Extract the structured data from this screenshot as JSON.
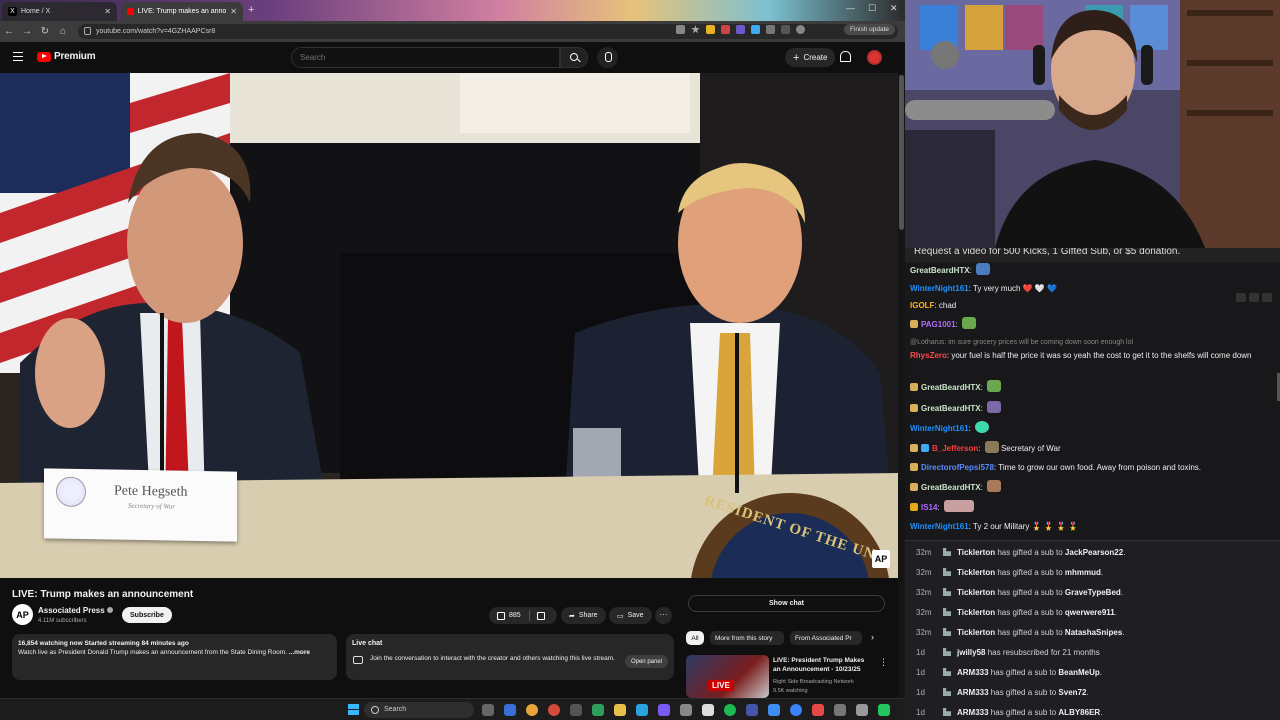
{
  "browser": {
    "tabs": [
      {
        "label": "Home / X",
        "active": false
      },
      {
        "label": "LIVE: Trump makes an anno",
        "active": true
      }
    ],
    "new_tab": "+",
    "url": "youtube.com/watch?v=4GZHAAPCsr8",
    "finish_update": "Finish update"
  },
  "yt": {
    "logo_text": "Premium",
    "search_placeholder": "Search",
    "create_label": "Create"
  },
  "video": {
    "nameplate_name": "Pete Hegseth",
    "nameplate_title": "Secretary of War",
    "seal_text": "RESIDENT OF THE UNI",
    "watermark": "AP"
  },
  "info": {
    "title": "LIVE: Trump makes an announcement",
    "channel_initials": "AP",
    "channel_name": "Associated Press",
    "subscribers": "4.11M subscribers",
    "subscribe_label": "Subscribe",
    "likes": "885",
    "share_label": "Share",
    "save_label": "Save",
    "more_label": "···",
    "stats": "16,854 watching now  Started streaming 84 minutes ago",
    "description": "Watch live as President Donald Trump makes an announcement from the State Dining Room.",
    "desc_more": "...more",
    "livechat_title": "Live chat",
    "livechat_desc": "Join the conversation to interact with the creator and others watching this live stream.",
    "open_panel": "Open panel",
    "show_chat": "Show chat"
  },
  "chips": [
    "All",
    "More from this story",
    "From Associated Pr"
  ],
  "recommendation": {
    "badge": "LIVE",
    "title": "LIVE: President Trump Makes an Announcement - 10/23/25",
    "channel": "Right Side Broadcasting Network",
    "watching": "9.5K watching"
  },
  "chat": {
    "banner": "Request a video for 500 Kicks, 1 Gifted Sub, or $5 donation.",
    "messages": [
      {
        "user": "GreatBeardHTX",
        "color": "#c9e6c9",
        "text": "",
        "emote": true
      },
      {
        "user": "WinterNight161",
        "color": "#1e90ff",
        "text": "Ty very much ❤️ 🤍 💙",
        "emote": false
      },
      {
        "user": "IGOLF",
        "color": "#ffb31a",
        "text": "chad",
        "emote": false
      },
      {
        "user": "PAG1001",
        "color": "#b16cff",
        "text": "",
        "emote": true
      },
      {
        "reply": "@Lotharus: im sure grocery prices will be coming down soon enough lol"
      },
      {
        "user": "RhysZero",
        "color": "#ff4a4a",
        "text": "your fuel is half the price it was so yeah the cost to get it to the shelfs will come down",
        "emote": false
      },
      {
        "user": "GreatBeardHTX",
        "color": "#c9e6c9",
        "text": "",
        "emote": true
      },
      {
        "user": "GreatBeardHTX",
        "color": "#c9e6c9",
        "text": "",
        "emote": true
      },
      {
        "user": "WinterNight161",
        "color": "#1e90ff",
        "text": "",
        "emote": true
      },
      {
        "user": "B_Jefferson",
        "color": "#ff3b3b",
        "text": "Secretary of War",
        "emote": true
      },
      {
        "user": "DirectorofPepsi578",
        "color": "#5b8cff",
        "text": "Time to grow our own food. Away from poison and toxins.",
        "emote": false
      },
      {
        "user": "GreatBeardHTX",
        "color": "#c9e6c9",
        "text": "",
        "emote": true
      },
      {
        "user": "IS14",
        "color": "#b16cff",
        "text": "",
        "emote": true
      },
      {
        "user": "WinterNight161",
        "color": "#1e90ff",
        "text": "Ty 2 our Military 🎖️ 🎖️ 🎖️ 🎖️",
        "emote": false
      }
    ]
  },
  "events": [
    {
      "time": "32m",
      "actor": "Ticklerton",
      "action": " has gifted a sub to ",
      "target": "JackPearson22",
      "tail": "."
    },
    {
      "time": "32m",
      "actor": "Ticklerton",
      "action": " has gifted a sub to ",
      "target": "mhmmud",
      "tail": "."
    },
    {
      "time": "32m",
      "actor": "Ticklerton",
      "action": " has gifted a sub to ",
      "target": "GraveTypeBed",
      "tail": "."
    },
    {
      "time": "32m",
      "actor": "Ticklerton",
      "action": " has gifted a sub to ",
      "target": "qwerwere911",
      "tail": "."
    },
    {
      "time": "32m",
      "actor": "Ticklerton",
      "action": " has gifted a sub to ",
      "target": "NatashaSnipes",
      "tail": "."
    },
    {
      "time": "1d",
      "actor": "jwilly58",
      "action": " has resubscribed for 21 months",
      "target": "",
      "tail": ""
    },
    {
      "time": "1d",
      "actor": "ARM333",
      "action": " has gifted a sub to ",
      "target": "BeanMeUp",
      "tail": "."
    },
    {
      "time": "1d",
      "actor": "ARM333",
      "action": " has gifted a sub to ",
      "target": "Sven72",
      "tail": "."
    },
    {
      "time": "1d",
      "actor": "ARM333",
      "action": " has gifted a sub to ",
      "target": "ALBY86ER",
      "tail": "."
    }
  ],
  "taskbar": {
    "search": "Search"
  }
}
